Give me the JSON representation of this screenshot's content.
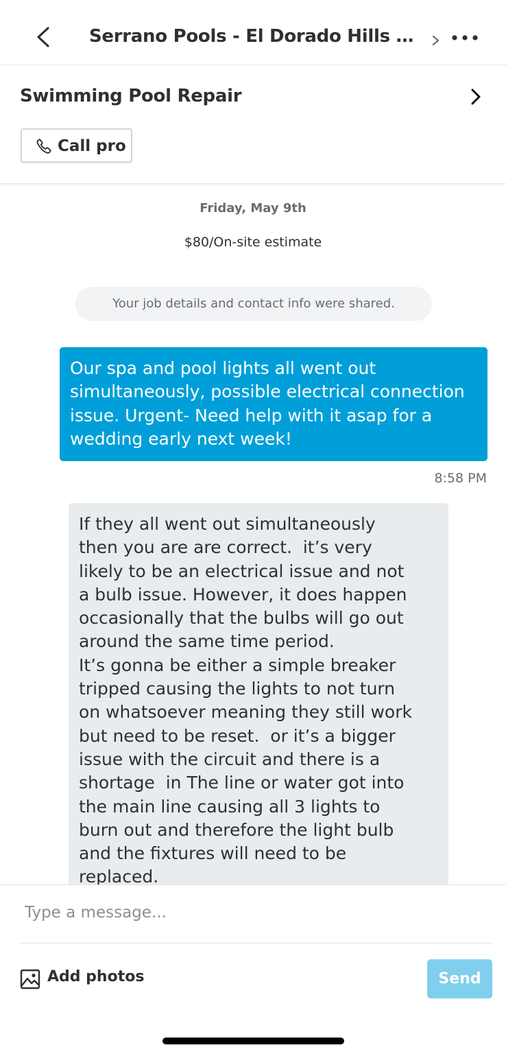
{
  "header": {
    "title": "Serrano Pools - El Dorado Hills and...",
    "back_icon": "chevron-left-icon",
    "chevron_icon": "chevron-right-icon",
    "more_icon": "more-horizontal-icon"
  },
  "service": {
    "title": "Swimming Pool Repair",
    "chevron_icon": "chevron-right-icon",
    "call_button": {
      "label": "Call pro",
      "icon": "phone-icon"
    }
  },
  "conversation": {
    "date": "Friday, May 9th",
    "estimate": "$80/On-site estimate",
    "system_notice": "Your job details and contact info were shared.",
    "messages": [
      {
        "direction": "outgoing",
        "text": "Our spa and pool lights all went out simultaneously, possible electrical connection issue. Urgent- Need help with it asap for a wedding early next week!",
        "time": "8:58 PM"
      },
      {
        "direction": "incoming",
        "text": "If they all went out simultaneously\nthen you are are correct.  it’s very\nlikely to be an electrical issue and not\na bulb issue. However, it does happen\noccasionally that the bulbs will go out\naround the same time period.\nIt’s gonna be either a simple breaker\ntripped causing the lights to not turn\non whatsoever meaning they still work\nbut need to be reset.  or it’s a bigger\nissue with the circuit and there is a\nshortage  in The line or water got into\nthe main line causing all 3 lights to\nburn out and therefore the light bulb\nand the fixtures will need to be\nreplaced."
      }
    ]
  },
  "composer": {
    "placeholder": "Type a message...",
    "add_photos_label": "Add photos",
    "add_photos_icon": "image-icon",
    "send_label": "Send"
  },
  "colors": {
    "accent": "#009fd9",
    "send_disabled": "#80cfec",
    "incoming_bubble": "#e9ecee",
    "text_primary": "#2f3033",
    "text_secondary": "#676d73"
  }
}
